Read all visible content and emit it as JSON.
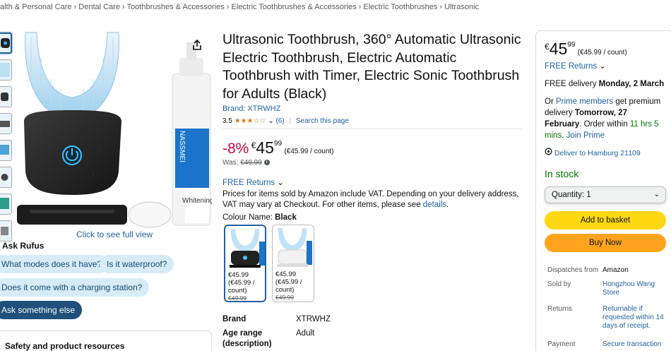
{
  "breadcrumb": "alth & Personal Care › Dental Care › Toothbrushes & Accessories › Electric Toothbrushes & Accessories › Electric Toothbrushes › Ultrasonic",
  "gallery": {
    "full_view": "Click to see full view",
    "product_label_brand": "NASSMEI",
    "product_label_name": "Whitening"
  },
  "rufus": {
    "title": "Ask Rufus",
    "chips": [
      "What modes does it have?",
      "Is it waterproof?",
      "Does it come with a charging station?"
    ],
    "ask_else": "Ask something else"
  },
  "safety": "Safety and product resources",
  "product": {
    "title": "Ultrasonic Toothbrush, 360° Automatic Ultrasonic Electric Toothbrush, Electric Automatic Toothbrush with Timer, Electric Sonic Toothbrush for Adults (Black)",
    "brand": "Brand: XTRWHZ",
    "rating": "3.5",
    "reviews": "(6)",
    "search_page": "Search this page",
    "discount": "-8%",
    "currency": "€",
    "price_whole": "45",
    "price_cents": "99",
    "unit_price": "(€45.99 / count)",
    "was_label": "Was:",
    "was_price": "€49.99",
    "free_returns": "FREE Returns",
    "vat_text": "Prices for items sold by Amazon include VAT. Depending on your delivery address, VAT may vary at Checkout. For other items, please see",
    "vat_link": "details",
    "colour_label": "Colour Name:",
    "colour_value": "Black",
    "swatches": [
      {
        "price": "€45.99",
        "unit": "(€45.99 / count)",
        "was": "€49.99"
      },
      {
        "price": "€45.99",
        "unit": "(€45.99 / count)",
        "was": "€49.99"
      }
    ],
    "specs": [
      {
        "key": "Brand",
        "value": "XTRWHZ"
      },
      {
        "key": "Age range (description)",
        "value": "Adult"
      }
    ]
  },
  "buybox": {
    "currency": "€",
    "price_whole": "45",
    "price_cents": "99",
    "unit_price": "(€45.99 / count)",
    "free_returns": "FREE Returns",
    "delivery_prefix": "FREE delivery",
    "delivery_date": "Monday, 2 March",
    "prime_or": "Or",
    "prime_link": "Prime members",
    "prime_text1": "get premium delivery",
    "prime_date": "Tomorrow, 27 February",
    "prime_text2": "Order within",
    "prime_countdown": "11 hrs 5 mins",
    "prime_join": "Join Prime",
    "deliver_to": "Deliver to Hamburg 21109",
    "stock": "In stock",
    "quantity": "Quantity: 1",
    "add_basket": "Add to basket",
    "buy_now": "Buy Now",
    "details": [
      {
        "key": "Dispatches from",
        "value": "Amazon"
      },
      {
        "key": "Sold by",
        "value": "Hongzhou Wang Store"
      },
      {
        "key": "Returns",
        "value": "Returnable if requested within 14 days of receipt."
      },
      {
        "key": "Payment",
        "value": "Secure transaction"
      }
    ]
  }
}
